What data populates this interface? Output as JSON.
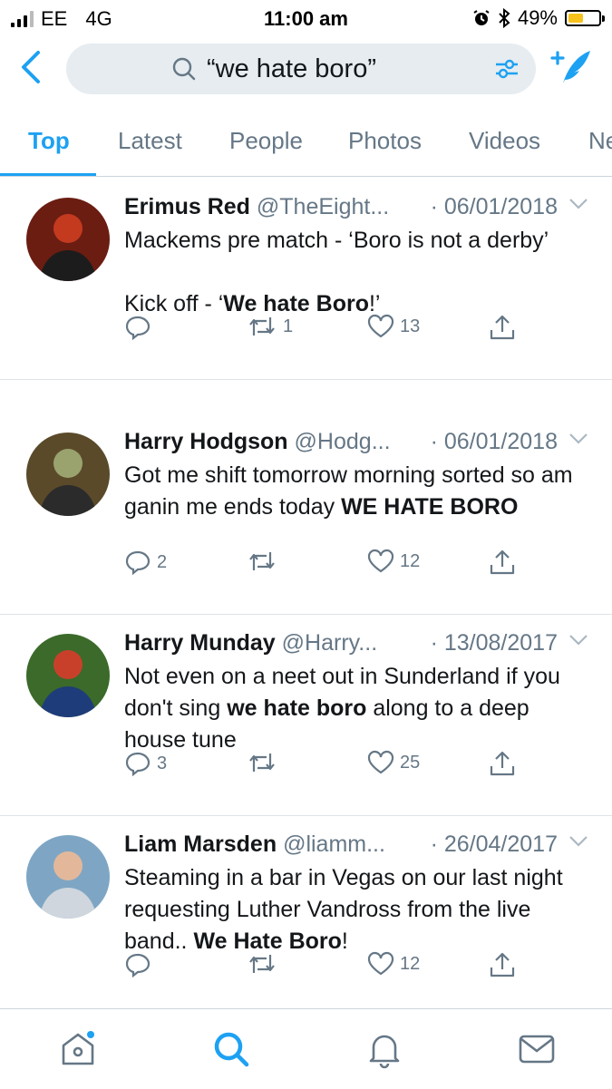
{
  "status_bar": {
    "carrier": "EE",
    "network": "4G",
    "time": "11:00 am",
    "battery_percent": "49%",
    "battery_level": 0.49,
    "icons": [
      "signal-icon",
      "alarm-icon",
      "bluetooth-icon",
      "battery-icon"
    ]
  },
  "search": {
    "query": "“we hate boro”"
  },
  "tabs": [
    {
      "label": "Top",
      "active": true
    },
    {
      "label": "Latest"
    },
    {
      "label": "People"
    },
    {
      "label": "Photos"
    },
    {
      "label": "Videos"
    },
    {
      "label": "News"
    }
  ],
  "tweets": [
    {
      "name": "Erimus Red",
      "handle": "@TheEight...",
      "date": "· 06/01/2018",
      "text_parts": [
        {
          "t": "Mackems pre match - ‘Boro is not a derby’\n\nKick off - ‘"
        },
        {
          "t": "We hate Boro",
          "b": true
        },
        {
          "t": "!’"
        }
      ],
      "replies": "",
      "retweets": "1",
      "likes": "13"
    },
    {
      "name": "Harry Hodgson",
      "handle": "@Hodg...",
      "date": "· 06/01/2018",
      "text_parts": [
        {
          "t": "Got me shift tomorrow morning sorted so am ganin me ends today "
        },
        {
          "t": "WE HATE BORO",
          "b": true
        }
      ],
      "replies": "2",
      "retweets": "",
      "likes": "12"
    },
    {
      "name": "Harry Munday",
      "handle": "@Harry...",
      "date": "· 13/08/2017",
      "text_parts": [
        {
          "t": "Not even on a neet out in Sunderland if you don't sing "
        },
        {
          "t": "we hate boro",
          "b": true
        },
        {
          "t": " along to a deep house tune"
        }
      ],
      "replies": "3",
      "retweets": "",
      "likes": "25"
    },
    {
      "name": "Liam Marsden",
      "handle": "@liamm...",
      "date": "· 26/04/2017",
      "text_parts": [
        {
          "t": "Steaming in a bar in Vegas on our last night requesting Luther Vandross from the live band.. "
        },
        {
          "t": "We Hate Boro",
          "b": true
        },
        {
          "t": "!"
        }
      ],
      "replies": "",
      "retweets": "",
      "likes": "12"
    }
  ],
  "colors": {
    "accent": "#1da1f2",
    "muted": "#657786",
    "text": "#14171a",
    "search_bg": "#e6ecf0",
    "battery_fill": "#f7c21b"
  },
  "bottom_nav": [
    "home-icon",
    "search-icon",
    "notifications-icon",
    "messages-icon"
  ]
}
